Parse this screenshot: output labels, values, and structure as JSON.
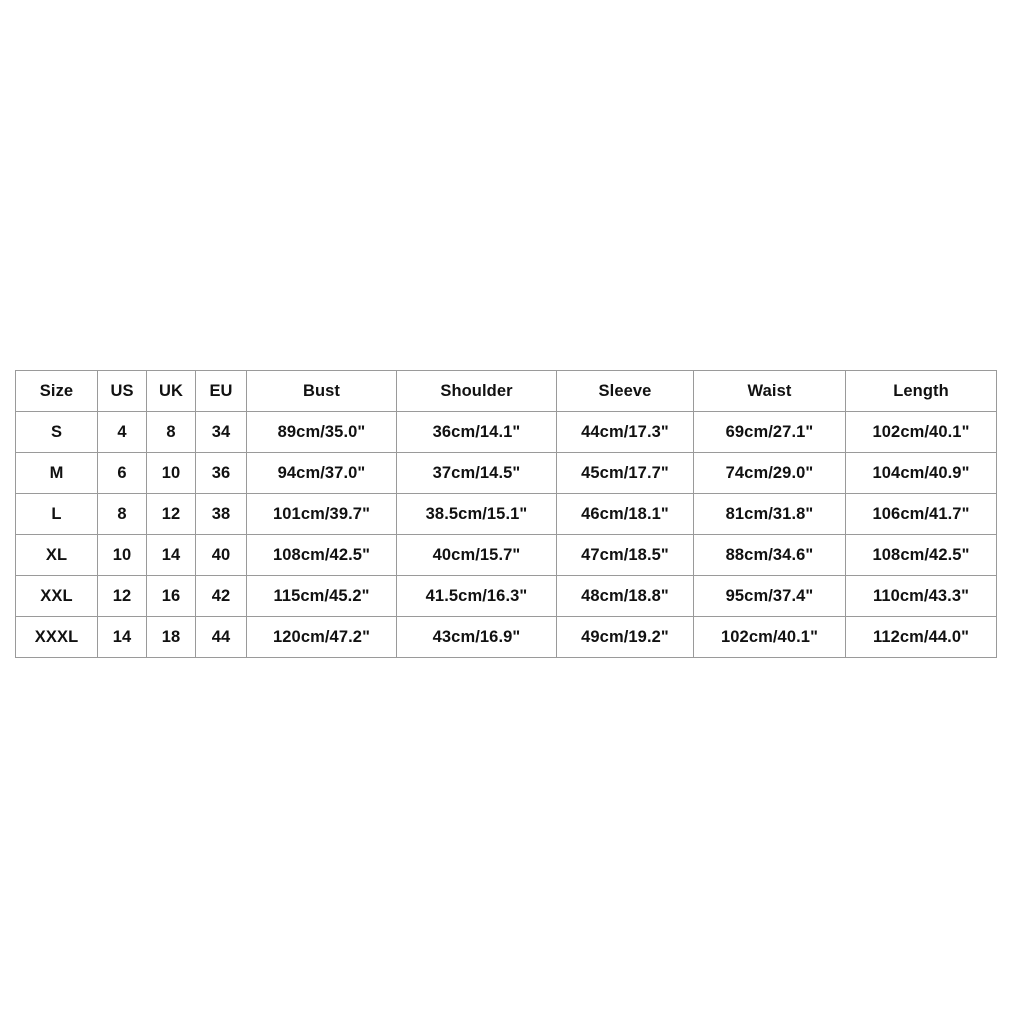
{
  "table": {
    "name": "size-chart",
    "columns": [
      "Size",
      "US",
      "UK",
      "EU",
      "Bust",
      "Shoulder",
      "Sleeve",
      "Waist",
      "Length"
    ],
    "rows": [
      {
        "size": "S",
        "us": "4",
        "uk": "8",
        "eu": "34",
        "bust": "89cm/35.0\"",
        "shoulder": "36cm/14.1\"",
        "sleeve": "44cm/17.3\"",
        "waist": "69cm/27.1\"",
        "length": "102cm/40.1\""
      },
      {
        "size": "M",
        "us": "6",
        "uk": "10",
        "eu": "36",
        "bust": "94cm/37.0\"",
        "shoulder": "37cm/14.5\"",
        "sleeve": "45cm/17.7\"",
        "waist": "74cm/29.0\"",
        "length": "104cm/40.9\""
      },
      {
        "size": "L",
        "us": "8",
        "uk": "12",
        "eu": "38",
        "bust": "101cm/39.7\"",
        "shoulder": "38.5cm/15.1\"",
        "sleeve": "46cm/18.1\"",
        "waist": "81cm/31.8\"",
        "length": "106cm/41.7\""
      },
      {
        "size": "XL",
        "us": "10",
        "uk": "14",
        "eu": "40",
        "bust": "108cm/42.5\"",
        "shoulder": "40cm/15.7\"",
        "sleeve": "47cm/18.5\"",
        "waist": "88cm/34.6\"",
        "length": "108cm/42.5\""
      },
      {
        "size": "XXL",
        "us": "12",
        "uk": "16",
        "eu": "42",
        "bust": "115cm/45.2\"",
        "shoulder": "41.5cm/16.3\"",
        "sleeve": "48cm/18.8\"",
        "waist": "95cm/37.4\"",
        "length": "110cm/43.3\""
      },
      {
        "size": "XXXL",
        "us": "14",
        "uk": "18",
        "eu": "44",
        "bust": "120cm/47.2\"",
        "shoulder": "43cm/16.9\"",
        "sleeve": "49cm/19.2\"",
        "waist": "102cm/40.1\"",
        "length": "112cm/44.0\""
      }
    ]
  },
  "colors": {
    "page_background": "#ffffff",
    "cell_background": "#ffffff",
    "border": "#9a9a9a",
    "text": "#111111"
  }
}
